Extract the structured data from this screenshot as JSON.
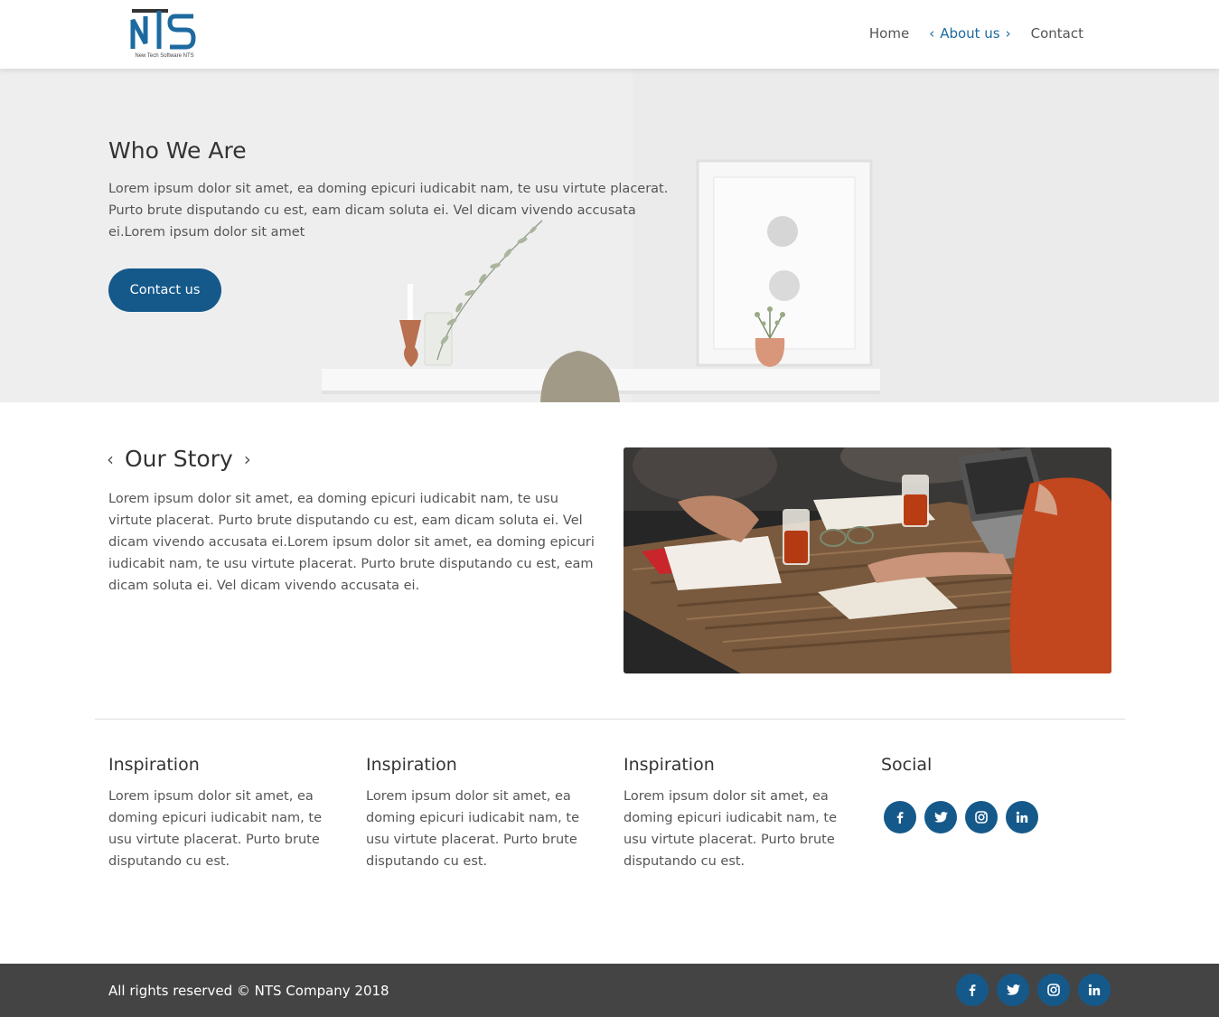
{
  "header": {
    "logo_tagline": "New Tech Software NTS",
    "nav": {
      "home": "Home",
      "about": "About us",
      "contact": "Contact"
    }
  },
  "hero": {
    "title": "Who We Are",
    "text": "Lorem ipsum dolor sit amet, ea doming epicuri iudicabit nam, te usu virtute placerat. Purto brute disputando cu est, eam dicam soluta ei. Vel dicam vivendo accusata ei.Lorem ipsum dolor sit amet",
    "button": "Contact us"
  },
  "story": {
    "title": "Our Story",
    "text": "Lorem ipsum dolor sit amet, ea doming epicuri iudicabit nam, te usu virtute placerat. Purto brute disputando cu est, eam dicam soluta ei. Vel dicam vivendo accusata ei.Lorem ipsum dolor sit amet, ea doming epicuri iudicabit nam, te usu virtute placerat. Purto brute disputando cu est, eam dicam soluta ei. Vel dicam vivendo accusata ei."
  },
  "columns": [
    {
      "title": "Inspiration",
      "text": "Lorem ipsum dolor sit amet, ea doming epicuri iudicabit nam, te usu virtute placerat. Purto brute disputando cu est."
    },
    {
      "title": "Inspiration",
      "text": "Lorem ipsum dolor sit amet, ea doming epicuri iudicabit nam, te usu virtute placerat. Purto brute disputando cu est."
    },
    {
      "title": "Inspiration",
      "text": "Lorem ipsum dolor sit amet, ea doming epicuri iudicabit nam, te usu virtute placerat. Purto brute disputando cu est."
    }
  ],
  "social": {
    "title": "Social",
    "icons": [
      "facebook-icon",
      "twitter-icon",
      "instagram-icon",
      "linkedin-icon"
    ]
  },
  "footer": {
    "copyright": "All rights reserved © NTS Company 2018"
  },
  "colors": {
    "brand": "#15598b",
    "nav_active": "#1d6aa0",
    "footer_bg": "#444444",
    "text": "#555555",
    "heading": "#333333"
  }
}
